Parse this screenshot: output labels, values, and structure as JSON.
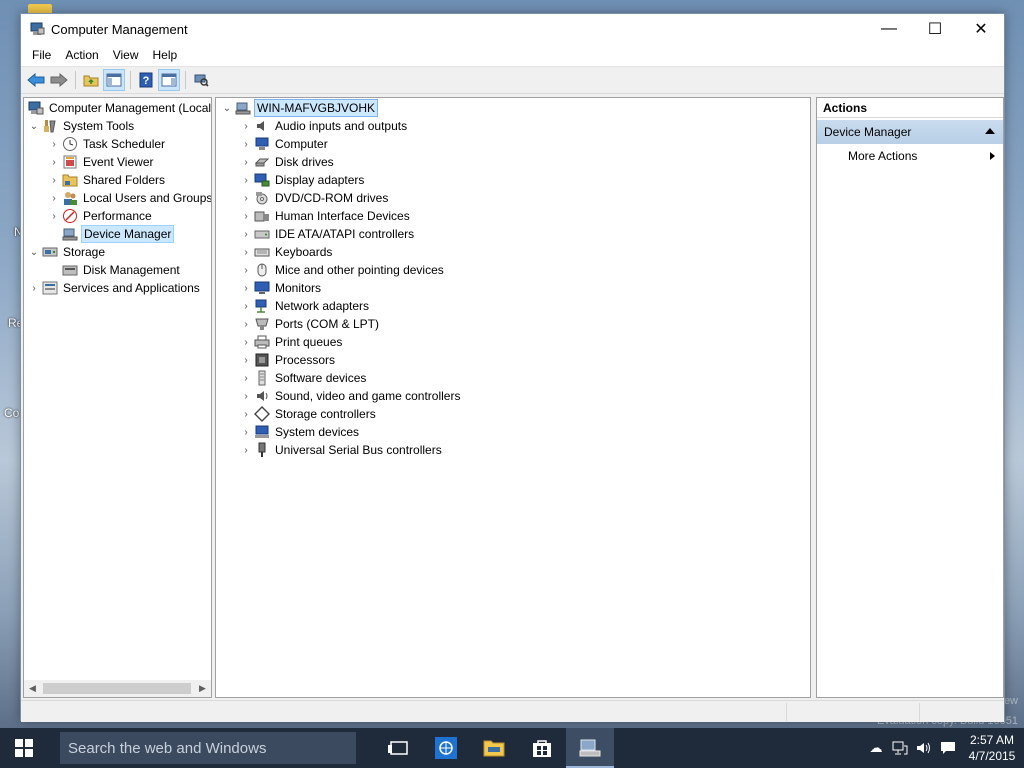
{
  "window": {
    "title": "Computer Management",
    "controls": {
      "minimize": "—",
      "maximize": "☐",
      "close": "✕"
    }
  },
  "menu": [
    "File",
    "Action",
    "View",
    "Help"
  ],
  "toolbar": {
    "buttons": [
      "back-icon",
      "forward-icon",
      "up-folder-icon",
      "show-hide-console-tree-icon",
      "help-icon",
      "show-hide-action-pane-icon",
      "scan-hardware-icon"
    ]
  },
  "left_tree": {
    "root": "Computer Management (Local",
    "system_tools": "System Tools",
    "task_scheduler": "Task Scheduler",
    "event_viewer": "Event Viewer",
    "shared_folders": "Shared Folders",
    "local_users": "Local Users and Groups",
    "performance": "Performance",
    "device_manager": "Device Manager",
    "storage": "Storage",
    "disk_management": "Disk Management",
    "services": "Services and Applications"
  },
  "devices": {
    "computer_name": "WIN-MAFVGBJVOHK",
    "categories": [
      "Audio inputs and outputs",
      "Computer",
      "Disk drives",
      "Display adapters",
      "DVD/CD-ROM drives",
      "Human Interface Devices",
      "IDE ATA/ATAPI controllers",
      "Keyboards",
      "Mice and other pointing devices",
      "Monitors",
      "Network adapters",
      "Ports (COM & LPT)",
      "Print queues",
      "Processors",
      "Software devices",
      "Sound, video and game controllers",
      "Storage controllers",
      "System devices",
      "Universal Serial Bus controllers"
    ]
  },
  "actions": {
    "header": "Actions",
    "section": "Device Manager",
    "more": "More Actions"
  },
  "taskbar": {
    "search_placeholder": "Search the web and Windows",
    "time": "2:57 AM",
    "date": "4/7/2015"
  },
  "desktop": {
    "watermark_line1": "ew",
    "watermark_line2": "Evaluation copy. Build 10051",
    "edge_labels": [
      "N",
      "Re",
      "Co"
    ]
  },
  "colors": {
    "selection": "#cce8ff",
    "actions_section": "#c9dcef",
    "taskbar": "#1f2b3b"
  }
}
